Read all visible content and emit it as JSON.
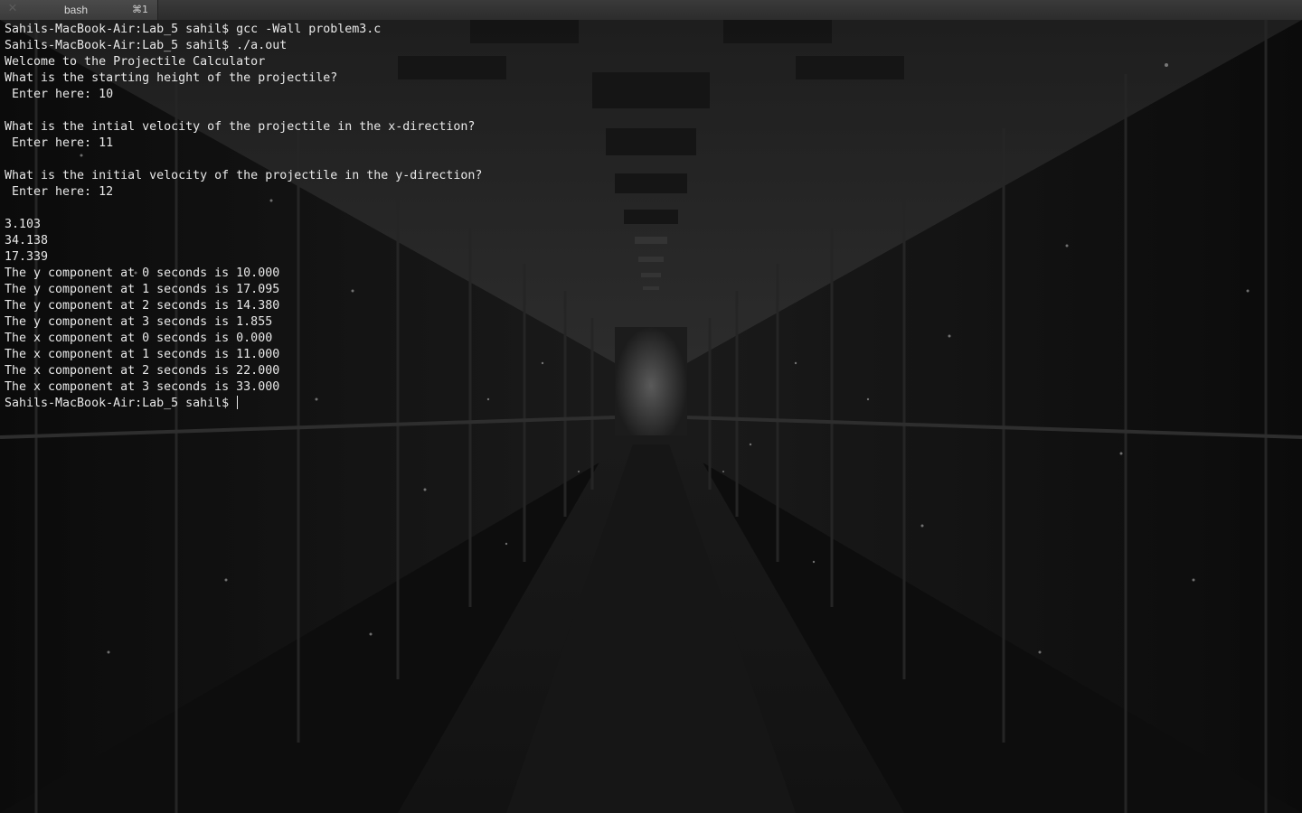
{
  "tab": {
    "close_glyph": "✕",
    "title": "bash",
    "shortcut": "⌘1"
  },
  "terminal": {
    "lines": [
      "Sahils-MacBook-Air:Lab_5 sahil$ gcc -Wall problem3.c",
      "Sahils-MacBook-Air:Lab_5 sahil$ ./a.out",
      "Welcome to the Projectile Calculator",
      "What is the starting height of the projectile?",
      " Enter here: 10",
      "",
      "What is the intial velocity of the projectile in the x-direction?",
      " Enter here: 11",
      "",
      "What is the initial velocity of the projectile in the y-direction?",
      " Enter here: 12",
      "",
      "3.103",
      "34.138",
      "17.339",
      "The y component at 0 seconds is 10.000",
      "The y component at 1 seconds is 17.095",
      "The y component at 2 seconds is 14.380",
      "The y component at 3 seconds is 1.855",
      "The x component at 0 seconds is 0.000",
      "The x component at 1 seconds is 11.000",
      "The x component at 2 seconds is 22.000",
      "The x component at 3 seconds is 33.000"
    ],
    "prompt": "Sahils-MacBook-Air:Lab_5 sahil$ "
  },
  "colors": {
    "text": "#e8e8e8",
    "background": "#101010",
    "tabbar": "#2c2c2c"
  }
}
